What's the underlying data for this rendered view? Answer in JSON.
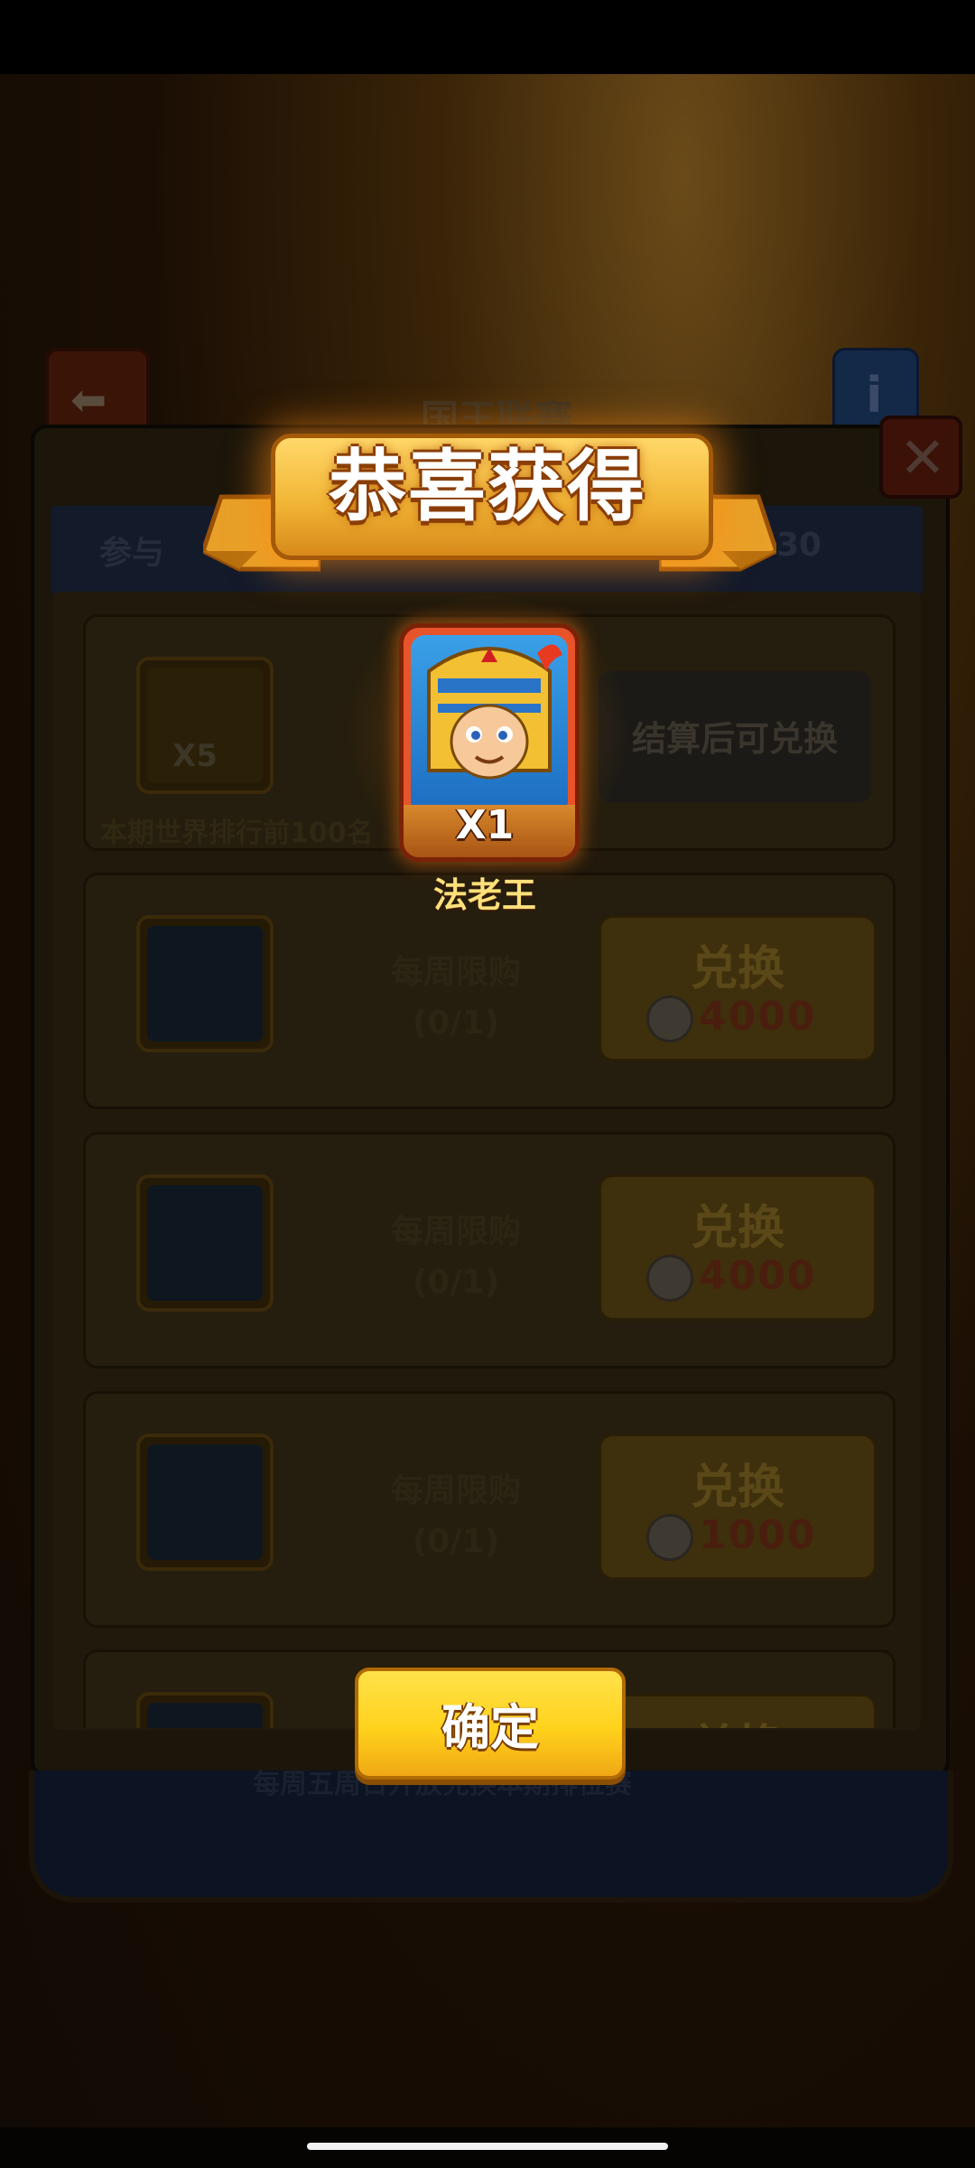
{
  "header": {
    "title": "国王联赛"
  },
  "panel": {
    "topbar_left": "参与",
    "topbar_right": "30",
    "footer_note": "每周五周日开放兑换本期排位赛",
    "items": [
      {
        "settle_label": "结算后可兑换",
        "count": "X5",
        "description": "本期世界排行前100名"
      },
      {
        "limit_label": "每周限购",
        "limit_value": "(0/1)",
        "button_label": "兑换",
        "price": "4000"
      },
      {
        "limit_label": "每周限购",
        "limit_value": "(0/1)",
        "button_label": "兑换",
        "price": "4000"
      },
      {
        "limit_label": "每周限购",
        "limit_value": "(0/1)",
        "button_label": "兑换",
        "price": "1000"
      },
      {
        "button_label": "兑换"
      }
    ]
  },
  "popup": {
    "title": "恭喜获得",
    "reward": {
      "count": "X1",
      "name": "法老王",
      "icon": "pharaoh-hero-portrait"
    },
    "confirm_label": "确定"
  },
  "colors": {
    "ribbon": "#f2b636",
    "confirm_button": "#ffd21c",
    "reward_name": "#ffe07a"
  }
}
